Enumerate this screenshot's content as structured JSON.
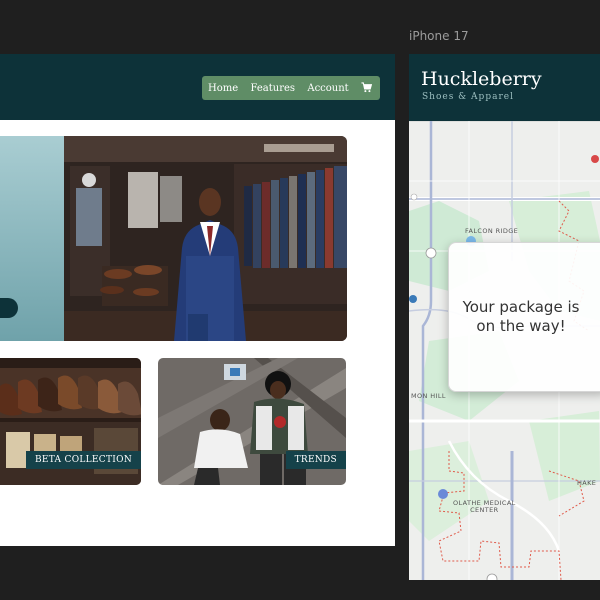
{
  "desktop": {
    "nav": {
      "home": "Home",
      "features": "Features",
      "account": "Account",
      "cart_icon": "cart-icon"
    },
    "cards": [
      {
        "label": "BETA COLLECTION"
      },
      {
        "label": "TRENDS"
      }
    ]
  },
  "phone": {
    "device_label": "iPhone 17",
    "brand": "Huckleberry",
    "tagline": "Shoes & Apparel",
    "map": {
      "labels": {
        "falcon_ridge": "FALCON RIDGE",
        "mon_hill": "MON HILL",
        "olathe": "OLATHE MEDICAL\nCENTER",
        "hake": "HAKE"
      }
    },
    "toast": "Your package is on the way!"
  },
  "colors": {
    "header": "#0d3239",
    "nav_bg": "#5f8d66",
    "label_bg": "#15424a",
    "canvas": "#1f1f1f"
  }
}
